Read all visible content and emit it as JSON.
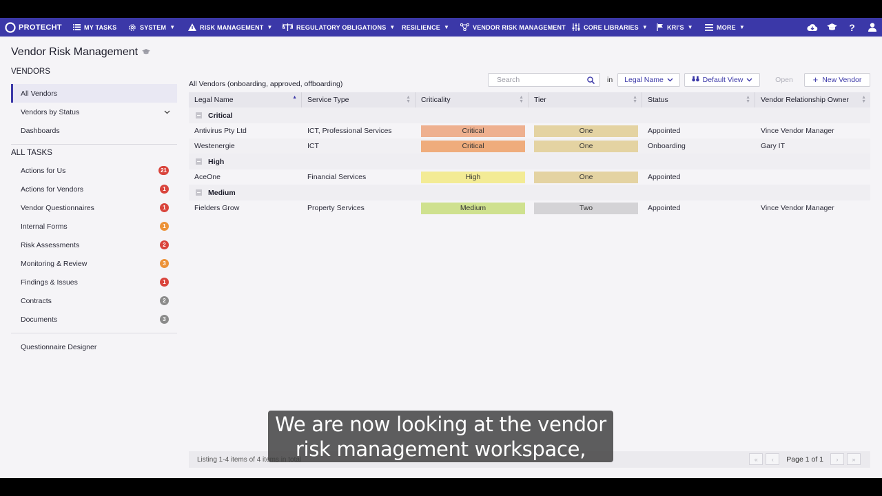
{
  "nav": {
    "brand": "PROTECHT",
    "items": [
      {
        "label": "MY TASKS",
        "icon": "list-icon",
        "caret": false
      },
      {
        "label": "SYSTEM",
        "icon": "gear-icon",
        "caret": true
      },
      {
        "label": "RISK MANAGEMENT",
        "icon": "warning-icon",
        "caret": true
      },
      {
        "label": "REGULATORY OBLIGATIONS",
        "icon": "scales-icon",
        "caret": true
      },
      {
        "label": "RESILIENCE",
        "icon": "",
        "caret": true
      },
      {
        "label": "VENDOR RISK MANAGEMENT",
        "icon": "network-icon",
        "caret": false
      },
      {
        "label": "CORE LIBRARIES",
        "icon": "sliders-icon",
        "caret": true
      },
      {
        "label": "KRI'S",
        "icon": "flag-icon",
        "caret": true
      },
      {
        "label": "MORE",
        "icon": "menu-icon",
        "caret": true
      }
    ],
    "right_icons": [
      "cloud-download-icon",
      "graduation-cap-icon",
      "help-icon",
      "user-icon"
    ]
  },
  "page": {
    "title": "Vendor Risk Management"
  },
  "sidebar": {
    "vendors_heading": "VENDORS",
    "vendors": [
      {
        "label": "All Vendors",
        "active": true
      },
      {
        "label": "Vendors by Status",
        "expand": true
      },
      {
        "label": "Dashboards"
      }
    ],
    "tasks_heading": "ALL TASKS",
    "tasks": [
      {
        "label": "Actions for Us",
        "count": "21",
        "color": "red"
      },
      {
        "label": "Actions for Vendors",
        "count": "1",
        "color": "red"
      },
      {
        "label": "Vendor Questionnaires",
        "count": "1",
        "color": "red"
      },
      {
        "label": "Internal Forms",
        "count": "1",
        "color": "orange"
      },
      {
        "label": "Risk Assessments",
        "count": "2",
        "color": "red"
      },
      {
        "label": "Monitoring & Review",
        "count": "3",
        "color": "orange"
      },
      {
        "label": "Findings & Issues",
        "count": "1",
        "color": "red"
      },
      {
        "label": "Contracts",
        "count": "2",
        "color": "grey"
      },
      {
        "label": "Documents",
        "count": "3",
        "color": "grey"
      }
    ],
    "designer": "Questionnaire Designer"
  },
  "toolbar": {
    "listing_title": "All Vendors (onboarding, approved, offboarding)",
    "search_placeholder": "Search",
    "in_label": "in",
    "field_select": "Legal Name",
    "view_select": "Default View",
    "open_label": "Open",
    "new_label": "New Vendor"
  },
  "grid": {
    "columns": [
      "Legal Name",
      "Service Type",
      "Criticality",
      "Tier",
      "Status",
      "Vendor Relationship Owner"
    ],
    "groups": [
      {
        "name": "Critical",
        "rows": [
          {
            "legal_name": "Antivirus Pty Ltd",
            "service_type": "ICT, Professional Services",
            "criticality": "Critical",
            "tier": "One",
            "status": "Appointed",
            "owner": "Vince Vendor Manager"
          },
          {
            "legal_name": "Westenergie",
            "service_type": "ICT",
            "criticality": "Critical",
            "tier": "One",
            "status": "Onboarding",
            "owner": "Gary IT"
          }
        ]
      },
      {
        "name": "High",
        "rows": [
          {
            "legal_name": "AceOne",
            "service_type": "Financial Services",
            "criticality": "High",
            "tier": "One",
            "status": "Appointed",
            "owner": ""
          }
        ]
      },
      {
        "name": "Medium",
        "rows": [
          {
            "legal_name": "Fielders Grow",
            "service_type": "Property Services",
            "criticality": "Medium",
            "tier": "Two",
            "status": "Appointed",
            "owner": "Vince Vendor Manager"
          }
        ]
      }
    ],
    "criticality_colors": {
      "Critical": "#eeb08f",
      "High": "#f3eb95",
      "Medium": "#cfe18f"
    },
    "critical_row2_color": "#efac7c",
    "tier_colors": {
      "One": "#e4d3a2",
      "Two": "#d4d3d6"
    }
  },
  "footer": {
    "listing": "Listing 1-4 items of 4 items in total",
    "page_text": "Page 1 of 1"
  },
  "caption": {
    "line1": "We are now looking at the vendor",
    "line2": "risk management workspace,"
  }
}
